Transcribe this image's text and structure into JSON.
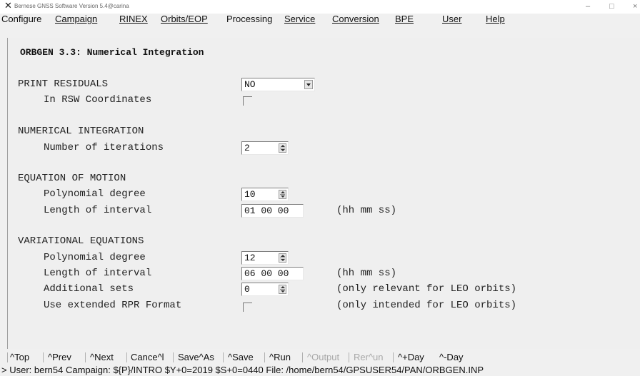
{
  "window": {
    "title": "Bernese GNSS Software Version 5.4@carina",
    "min": "–",
    "max": "□",
    "close": "×"
  },
  "menu": [
    {
      "label": "Configure",
      "ul": false
    },
    {
      "label": "Campaign",
      "ul": true
    },
    {
      "label": "RINEX",
      "ul": true
    },
    {
      "label": "Orbits/EOP",
      "ul": true
    },
    {
      "label": "Processing",
      "ul": false
    },
    {
      "label": "Service",
      "ul": true
    },
    {
      "label": "Conversion",
      "ul": true
    },
    {
      "label": "BPE",
      "ul": true
    },
    {
      "label": "User",
      "ul": true
    },
    {
      "label": "Help",
      "ul": true
    }
  ],
  "panel": {
    "heading": "ORBGEN 3.3: Numerical Integration",
    "print_residuals": {
      "label": "PRINT RESIDUALS",
      "value": "NO"
    },
    "rsw": {
      "label": "In RSW Coordinates",
      "checked": false
    },
    "numint": {
      "label": "NUMERICAL INTEGRATION"
    },
    "iterations": {
      "label": "Number of iterations",
      "value": "2"
    },
    "eom": {
      "label": "EQUATION OF MOTION"
    },
    "eom_degree": {
      "label": "Polynomial degree",
      "value": "10"
    },
    "eom_interval": {
      "label": "Length of interval",
      "value": "01 00 00",
      "unit": "(hh mm ss)"
    },
    "var": {
      "label": "VARIATIONAL EQUATIONS"
    },
    "var_degree": {
      "label": "Polynomial degree",
      "value": "12"
    },
    "var_interval": {
      "label": "Length of interval",
      "value": "06 00 00",
      "unit": "(hh mm ss)"
    },
    "var_sets": {
      "label": "Additional sets",
      "value": "0",
      "note": "(only relevant for LEO orbits)"
    },
    "var_rpr": {
      "label": "Use extended RPR Format",
      "checked": false,
      "note": "(only intended for LEO orbits)"
    }
  },
  "toolbar": [
    {
      "label": "^Top",
      "enabled": true
    },
    {
      "label": "^Prev",
      "enabled": true
    },
    {
      "label": "^Next",
      "enabled": true
    },
    {
      "label": "Cance^l",
      "enabled": true
    },
    {
      "label": "Save^As",
      "enabled": true
    },
    {
      "label": "^Save",
      "enabled": true
    },
    {
      "label": "^Run",
      "enabled": true
    },
    {
      "label": "^Output",
      "enabled": false
    },
    {
      "label": "Rer^un",
      "enabled": false
    },
    {
      "label": "^+Day",
      "enabled": true
    },
    {
      "label": "^-Day",
      "enabled": true
    }
  ],
  "status": "> User: bern54  Campaign: ${P}/INTRO  $Y+0=2019  $S+0=0440  File: /home/bern54/GPSUSER54/PAN/ORBGEN.INP"
}
